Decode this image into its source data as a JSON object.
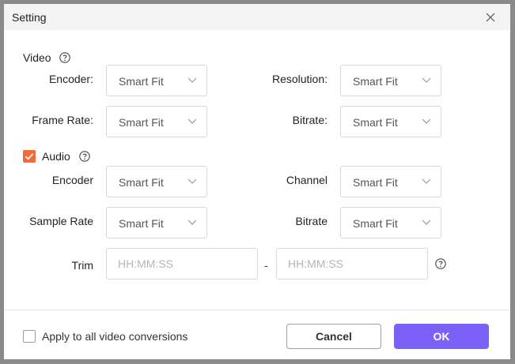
{
  "dialog": {
    "title": "Setting",
    "close_icon": "close-icon"
  },
  "video": {
    "section_label": "Video",
    "encoder_label": "Encoder:",
    "encoder_value": "Smart Fit",
    "resolution_label": "Resolution:",
    "resolution_value": "Smart Fit",
    "frame_rate_label": "Frame Rate:",
    "frame_rate_value": "Smart Fit",
    "bitrate_label": "Bitrate:",
    "bitrate_value": "Smart Fit"
  },
  "audio": {
    "section_label": "Audio",
    "checked": true,
    "encoder_label": "Encoder",
    "encoder_value": "Smart Fit",
    "channel_label": "Channel",
    "channel_value": "Smart Fit",
    "sample_rate_label": "Sample Rate",
    "sample_rate_value": "Smart Fit",
    "bitrate_label": "Bitrate",
    "bitrate_value": "Smart Fit"
  },
  "trim": {
    "label": "Trim",
    "start_placeholder": "HH:MM:SS",
    "end_placeholder": "HH:MM:SS",
    "separator": "-"
  },
  "footer": {
    "apply_all_label": "Apply to all video conversions",
    "apply_all_checked": false,
    "cancel_label": "Cancel",
    "ok_label": "OK"
  },
  "colors": {
    "accent": "#7b61f7",
    "checkbox": "#f16a3a"
  }
}
